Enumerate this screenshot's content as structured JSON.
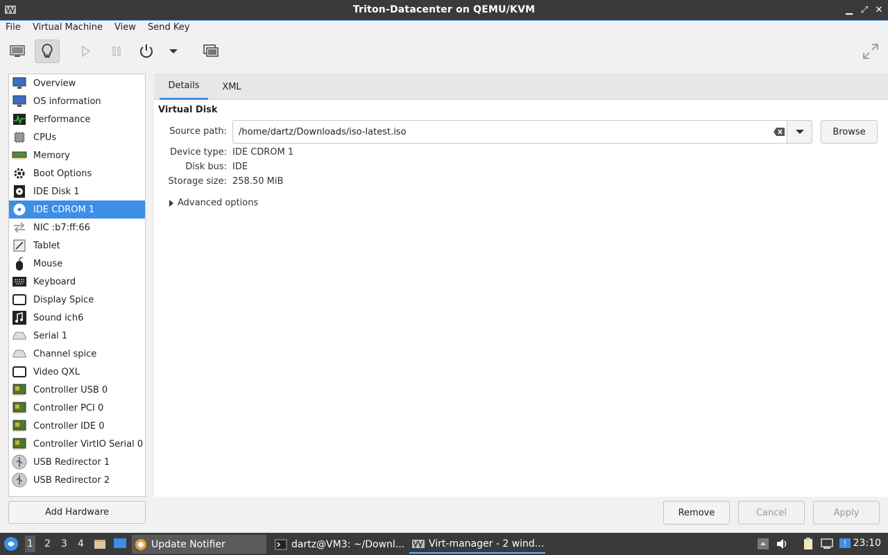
{
  "window": {
    "title": "Triton-Datacenter on QEMU/KVM",
    "controls": {
      "minimize": "▁",
      "maximize": "⤢",
      "close": "✕"
    }
  },
  "menu": [
    "File",
    "Virtual Machine",
    "View",
    "Send Key"
  ],
  "toolbar": {
    "icons": [
      "console-icon",
      "details-lightbulb-icon",
      "run-icon",
      "pause-icon",
      "power-icon",
      "power-menu-chevron-icon",
      "snapshots-icon",
      "fullscreen-icon"
    ]
  },
  "sidebar": {
    "items": [
      {
        "label": "Overview",
        "icon": "monitor-icon"
      },
      {
        "label": "OS information",
        "icon": "monitor-icon"
      },
      {
        "label": "Performance",
        "icon": "performance-graph-icon"
      },
      {
        "label": "CPUs",
        "icon": "cpu-chip-icon"
      },
      {
        "label": "Memory",
        "icon": "memory-module-icon"
      },
      {
        "label": "Boot Options",
        "icon": "gear-icon"
      },
      {
        "label": "IDE Disk 1",
        "icon": "disk-icon"
      },
      {
        "label": "IDE CDROM 1",
        "icon": "cdrom-icon",
        "selected": true
      },
      {
        "label": "NIC :b7:ff:66",
        "icon": "network-arrows-icon"
      },
      {
        "label": "Tablet",
        "icon": "tablet-icon"
      },
      {
        "label": "Mouse",
        "icon": "mouse-icon"
      },
      {
        "label": "Keyboard",
        "icon": "keyboard-icon"
      },
      {
        "label": "Display Spice",
        "icon": "display-icon"
      },
      {
        "label": "Sound ich6",
        "icon": "sound-icon"
      },
      {
        "label": "Serial 1",
        "icon": "serial-port-icon"
      },
      {
        "label": "Channel spice",
        "icon": "channel-icon"
      },
      {
        "label": "Video QXL",
        "icon": "video-icon"
      },
      {
        "label": "Controller USB 0",
        "icon": "controller-card-icon"
      },
      {
        "label": "Controller PCI 0",
        "icon": "controller-card-icon"
      },
      {
        "label": "Controller IDE 0",
        "icon": "controller-card-icon"
      },
      {
        "label": "Controller VirtIO Serial 0",
        "icon": "controller-card-icon"
      },
      {
        "label": "USB Redirector 1",
        "icon": "usb-icon"
      },
      {
        "label": "USB Redirector 2",
        "icon": "usb-icon"
      }
    ],
    "add_hardware": "Add Hardware"
  },
  "details": {
    "tabs": [
      "Details",
      "XML"
    ],
    "section_title": "Virtual Disk",
    "source_path_label": "Source path:",
    "source_path_value": "/home/dartz/Downloads/iso-latest.iso",
    "browse_label": "Browse",
    "device_type_label": "Device type:",
    "device_type_value": "IDE CDROM 1",
    "disk_bus_label": "Disk bus:",
    "disk_bus_value": "IDE",
    "storage_size_label": "Storage size:",
    "storage_size_value": "258.50 MiB",
    "advanced_label": "Advanced options"
  },
  "actions": {
    "remove": "Remove",
    "cancel": "Cancel",
    "apply": "Apply"
  },
  "taskbar": {
    "workspaces": [
      "1",
      "2",
      "3",
      "4"
    ],
    "tasks": [
      {
        "label": "Update Notifier",
        "icon": "update-notifier-icon"
      },
      {
        "label": "dartz@VM3: ~/Downl...",
        "icon": "terminal-icon"
      },
      {
        "label": "Virt-manager - 2 wind...",
        "icon": "virt-manager-icon",
        "active": true
      }
    ],
    "clock": "23:10"
  },
  "colors": {
    "accent": "#3d8ee6",
    "titlebar": "#3a3a3a",
    "panel_tabs": "#e7e7e7"
  }
}
